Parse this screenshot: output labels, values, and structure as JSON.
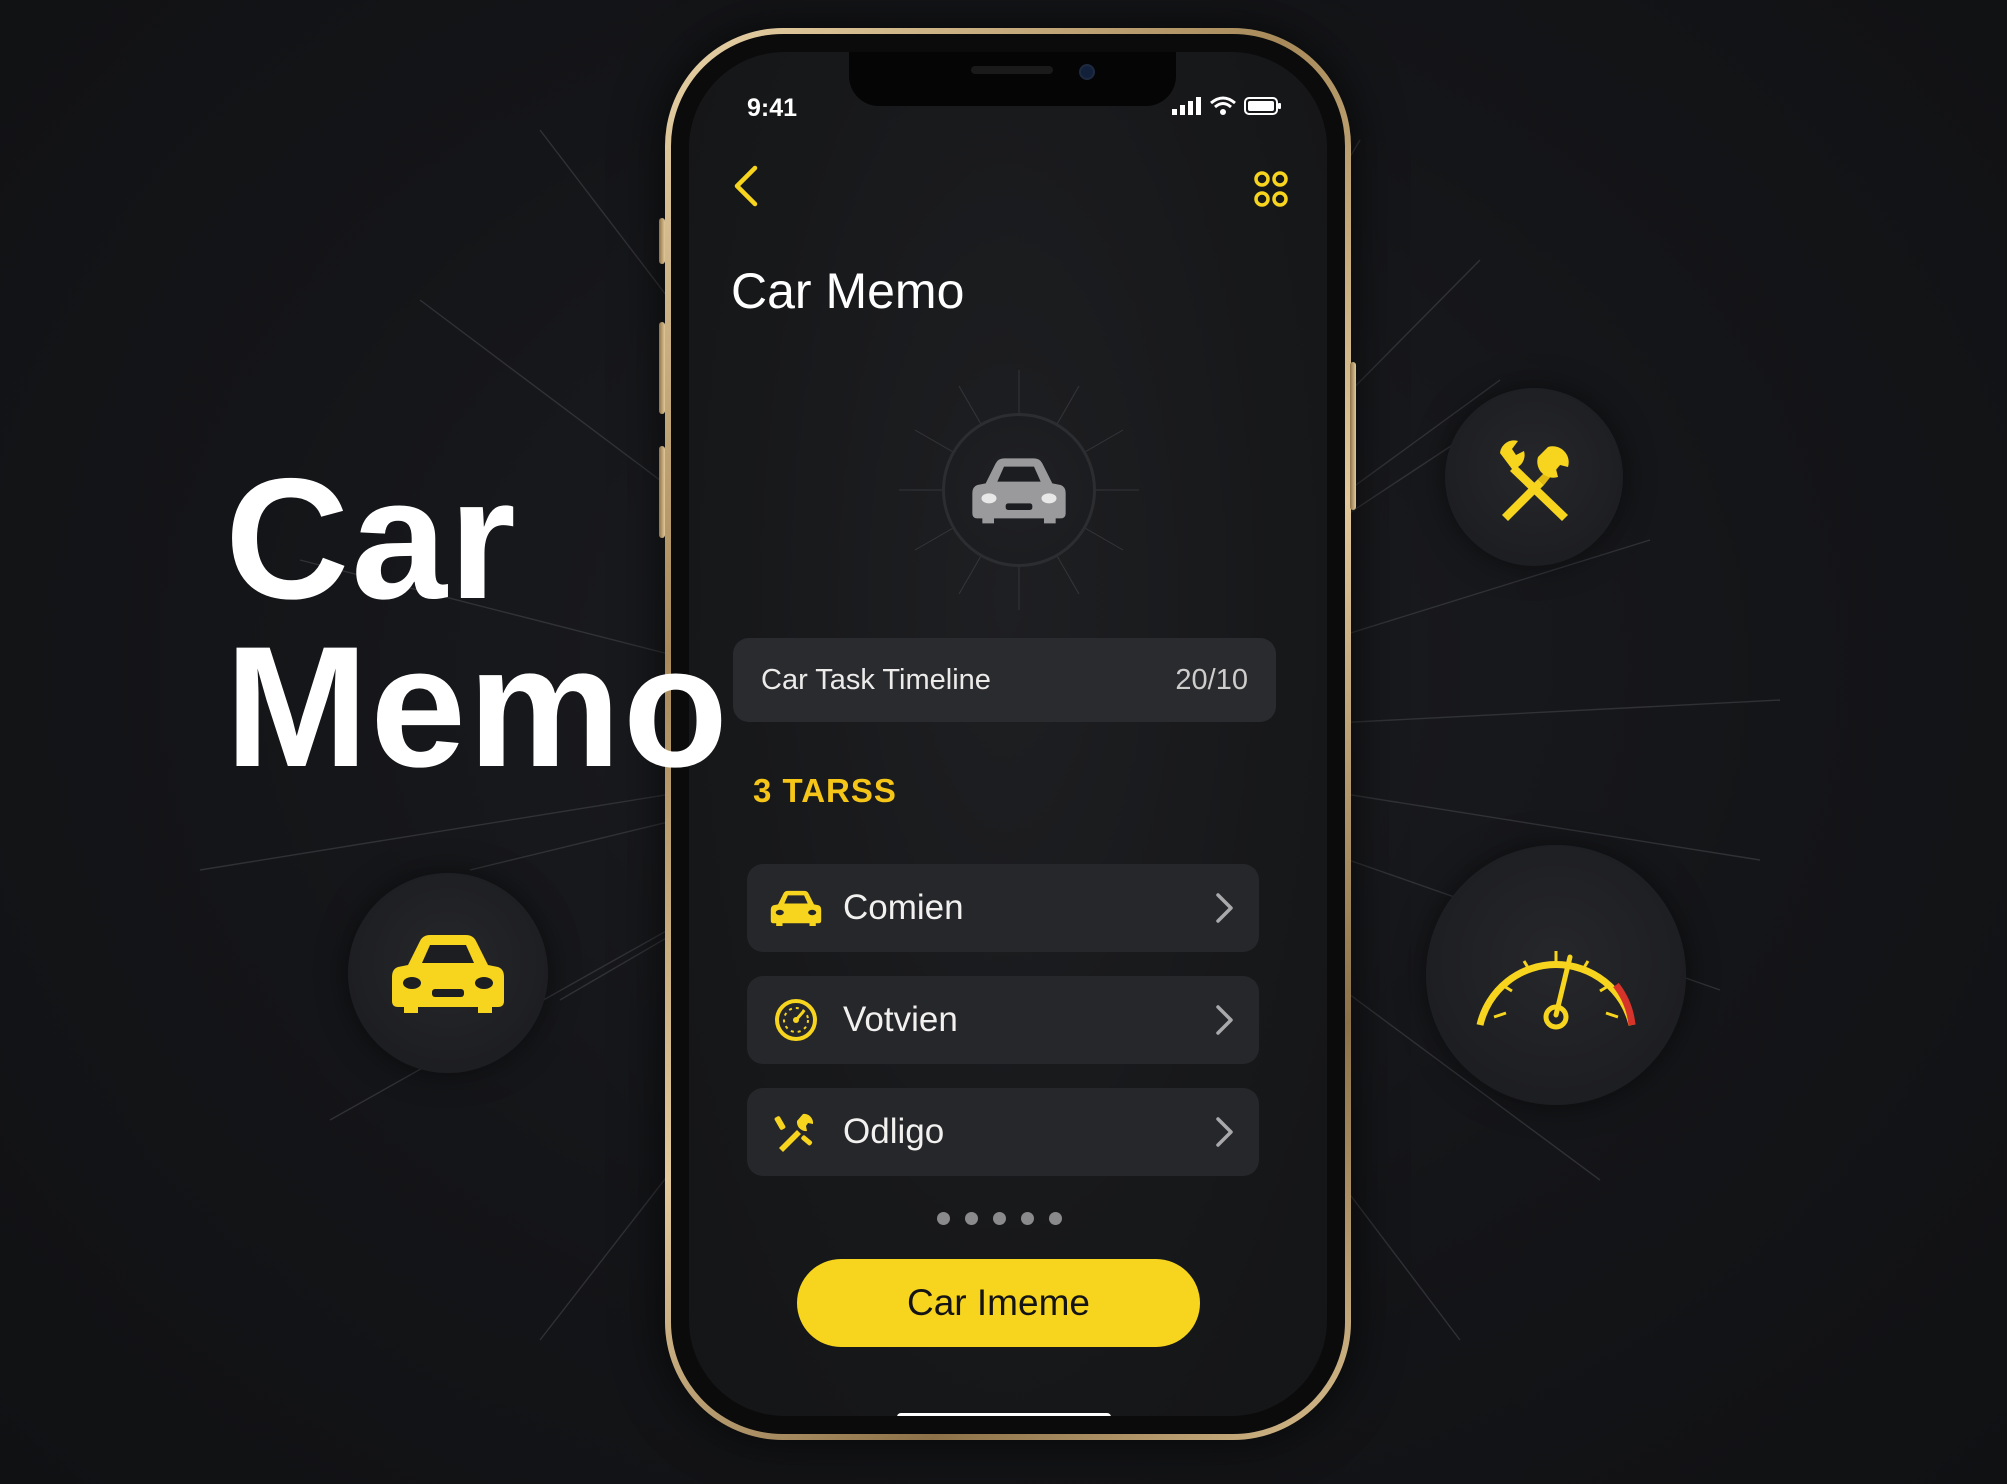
{
  "hero": {
    "line1": "Car",
    "line2": "Memo"
  },
  "status_bar": {
    "time": "9:41"
  },
  "screen": {
    "title": "Car Memo",
    "timeline": {
      "label": "Car Task Timeline",
      "count": "20/10"
    },
    "section_label": "3 TARSS",
    "tasks": [
      {
        "label": "Comien",
        "icon": "car-icon"
      },
      {
        "label": "Votvien",
        "icon": "gauge-icon"
      },
      {
        "label": "Odligo",
        "icon": "tools-icon"
      }
    ],
    "pagination": {
      "total": 5
    },
    "cta_label": "Car Imeme"
  },
  "floating_icons": [
    "wrench-screwdriver-icon",
    "speedometer-icon",
    "car-icon"
  ],
  "colors": {
    "accent": "#f7d51e",
    "background": "#131417",
    "card": "#26272b",
    "text": "#ffffff"
  }
}
